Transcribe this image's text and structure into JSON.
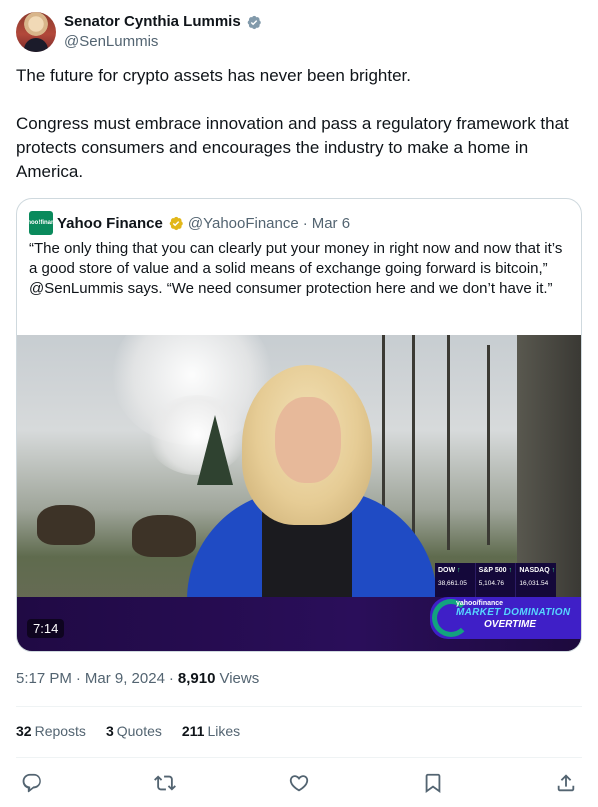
{
  "author": {
    "display_name": "Senator Cynthia Lummis",
    "handle": "@SenLummis",
    "verified_badge_icon": "verified-badge-icon"
  },
  "tweet": {
    "text": "The future for crypto assets has never been brighter.\n\nCongress must embrace innovation and pass a regulatory framework that protects consumers and encourages the industry to make a home in America."
  },
  "quote": {
    "logo_text": "yahoo!finance",
    "name": "Yahoo Finance",
    "handle": "@YahooFinance",
    "separator": "·",
    "date": "Mar 6",
    "text": "“The only thing that you can clearly put your money in right now and now that it’s a good store of value and a solid means of exchange going forward is bitcoin,” @SenLummis says. “We need consumer protection here and we don’t have it.”",
    "video": {
      "duration": "7:14",
      "ticker": [
        {
          "label": "DOW",
          "value": "38,661.05"
        },
        {
          "label": "S&P 500",
          "value": "5,104.76"
        },
        {
          "label": "NASDAQ",
          "value": "16,031.54"
        }
      ],
      "show_brand": "yahoo/finance",
      "show_title_1": "MARKET DOMINATION",
      "show_title_2": "OVERTIME",
      "up_arrow": "↑"
    }
  },
  "meta": {
    "time": "5:17 PM",
    "sep1": "·",
    "date": "Mar 9, 2024",
    "sep2": "·",
    "views_count": "8,910",
    "views_label": "Views"
  },
  "stats": {
    "reposts_count": "32",
    "reposts_label": "Reposts",
    "quotes_count": "3",
    "quotes_label": "Quotes",
    "likes_count": "211",
    "likes_label": "Likes"
  },
  "actions": [
    "reply-icon",
    "repost-icon",
    "like-icon",
    "bookmark-icon",
    "share-icon"
  ],
  "colors": {
    "text": "#0f1419",
    "secondary": "#536471",
    "border": "#cfd9de",
    "verified_blue": "#1d9bf0",
    "verified_gold": "#e2b719"
  }
}
